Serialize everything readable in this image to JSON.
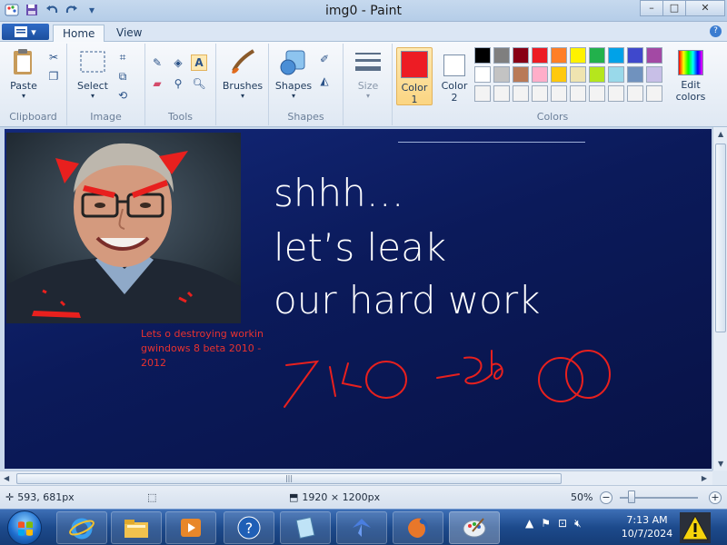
{
  "window": {
    "title": "img0 - Paint",
    "minimize": "–",
    "maximize": "□",
    "close": "✕"
  },
  "qat": {
    "save": "save-icon",
    "undo": "undo-icon",
    "redo": "redo-icon",
    "customize": "▾"
  },
  "tabs": [
    {
      "label": "Home",
      "active": true
    },
    {
      "label": "View",
      "active": false
    }
  ],
  "help": "?",
  "ribbon": {
    "clipboard": {
      "label": "Clipboard",
      "paste": "Paste"
    },
    "image": {
      "label": "Image",
      "select": "Select"
    },
    "tools": {
      "label": "Tools"
    },
    "brushes": {
      "label": "Brushes"
    },
    "shapes": {
      "label": "Shapes",
      "button": "Shapes"
    },
    "size": {
      "label": "Size"
    },
    "colors": {
      "label": "Colors",
      "color1_label": "Color",
      "color1_num": "1",
      "color2_label": "Color",
      "color2_num": "2",
      "color1_value": "#ed1c24",
      "color2_value": "#ffffff",
      "edit_label": "Edit",
      "edit_label2": "colors",
      "palette": [
        "#000000",
        "#7f7f7f",
        "#880015",
        "#ed1c24",
        "#ff7f27",
        "#fff200",
        "#22b14c",
        "#00a2e8",
        "#3f48cc",
        "#a349a4",
        "#ffffff",
        "#c3c3c3",
        "#b97a57",
        "#ffaec9",
        "#ffc90e",
        "#efe4b0",
        "#b5e61d",
        "#99d9ea",
        "#7092be",
        "#c8bfe7",
        "#f3f3f3",
        "#f3f3f3",
        "#f3f3f3",
        "#f3f3f3",
        "#f3f3f3",
        "#f3f3f3",
        "#f3f3f3",
        "#f3f3f3",
        "#f3f3f3",
        "#f3f3f3"
      ]
    }
  },
  "canvas": {
    "line1": "shhh…",
    "line2": "let’s leak",
    "line3": "our hard work",
    "note_line1": "Lets o destroying workin",
    "note_line2": "gwindows 8 beta 2010 -",
    "note_line3": "2012"
  },
  "status": {
    "cursor_pos": "593, 681px",
    "image_size": "1920 × 1200px",
    "zoom": "50%",
    "zoom_fraction": 0.5
  },
  "taskbar": {
    "time": "7:13 AM",
    "date": "10/7/2024"
  }
}
